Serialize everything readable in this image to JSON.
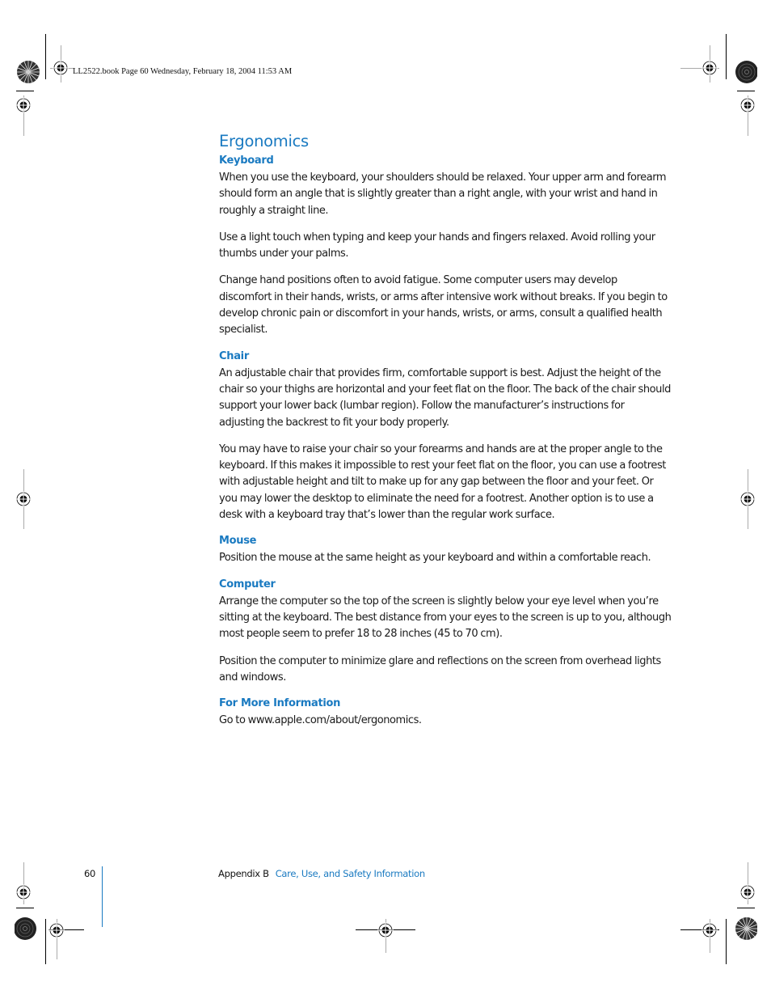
{
  "slug": {
    "text": "LL2522.book  Page 60  Wednesday, February 18, 2004  11:53 AM"
  },
  "title": "Ergonomics",
  "sections": [
    {
      "heading": "Keyboard",
      "paragraphs": [
        "When you use the keyboard, your shoulders should be relaxed. Your upper arm and forearm should form an angle that is slightly greater than a right angle, with your wrist and hand in roughly a straight line.",
        "Use a light touch when typing and keep your hands and fingers relaxed. Avoid rolling your thumbs under your palms.",
        "Change hand positions often to avoid fatigue. Some computer users may develop discomfort in their hands, wrists, or arms after intensive work without breaks. If you begin to develop chronic pain or discomfort in your hands, wrists, or arms, consult a qualified health specialist."
      ]
    },
    {
      "heading": "Chair",
      "paragraphs": [
        "An adjustable chair that provides firm, comfortable support is best. Adjust the height of the chair so your thighs are horizontal and your feet flat on the floor. The back of the chair should support your lower back (lumbar region). Follow the manufacturer’s instructions for adjusting the backrest to fit your body properly.",
        "You may have to raise your chair so your forearms and hands are at the proper angle to the keyboard. If this makes it impossible to rest your feet flat on the floor, you can use a footrest with adjustable height and tilt to make up for any gap between the floor and your feet. Or you may lower the desktop to eliminate the need for a footrest. Another option is to use a desk with a keyboard tray that’s lower than the regular work surface."
      ]
    },
    {
      "heading": "Mouse",
      "paragraphs": [
        "Position the mouse at the same height as your keyboard and within a comfortable reach."
      ]
    },
    {
      "heading": "Computer",
      "paragraphs": [
        "Arrange the computer so the top of the screen is slightly below your eye level when you’re sitting at the keyboard. The best distance from your eyes to the screen is up to you, although most people seem to prefer 18 to 28 inches (45 to 70 cm).",
        "Position the computer to minimize glare and reflections on the screen from overhead lights and windows."
      ]
    },
    {
      "heading": "For More Information",
      "paragraphs": [
        "Go to www.apple.com/about/ergonomics."
      ]
    }
  ],
  "footer": {
    "page_number": "60",
    "appendix": "Appendix B",
    "chapter": "Care, Use, and Safety Information"
  },
  "colors": {
    "accent": "#1a7ac1",
    "text": "#1a1a1a"
  },
  "icons": {
    "registration_mark": "registration-mark-icon",
    "star_target": "star-target-icon"
  }
}
